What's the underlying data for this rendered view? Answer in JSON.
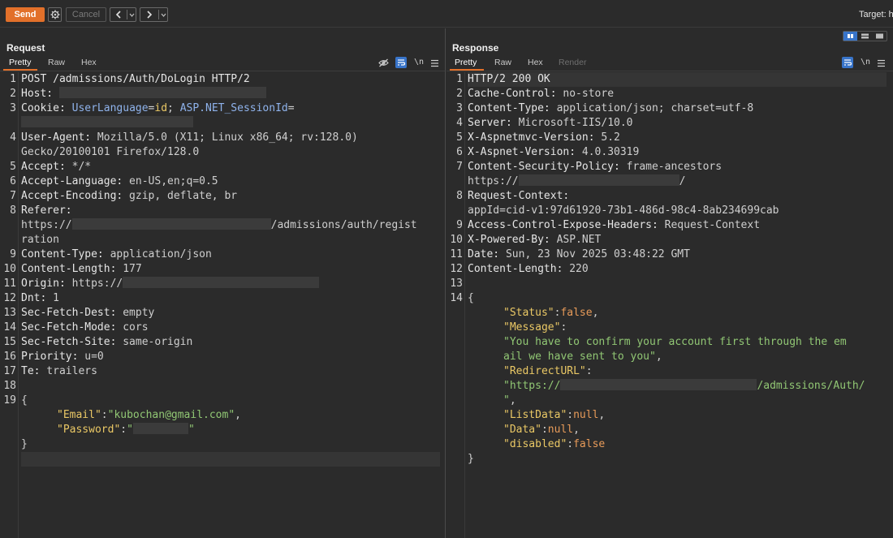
{
  "toolbar": {
    "send_label": "Send",
    "cancel_label": "Cancel",
    "target_label": "Target: h"
  },
  "request": {
    "title": "Request",
    "tabs": [
      "Pretty",
      "Raw",
      "Hex"
    ],
    "lines": {
      "l1": "POST /admissions/Auth/DoLogin HTTP/2",
      "l2k": "Host:",
      "l3k": "Cookie:",
      "l3a": "UserLanguage",
      "l3b": "=",
      "l3c": "id",
      "l3d": "; ",
      "l3e": "ASP.NET_SessionId",
      "l3f": "=",
      "l4k": "User-Agent:",
      "l4v": " Mozilla/5.0 (X11; Linux x86_64; rv:128.0)",
      "l4c": "Gecko/20100101 Firefox/128.0",
      "l5k": "Accept:",
      "l5v": " */*",
      "l6k": "Accept-Language:",
      "l6v": " en-US,en;q=0.5",
      "l7k": "Accept-Encoding:",
      "l7v": " gzip, deflate, br",
      "l8k": "Referer:",
      "l8a": "https://",
      "l8b": "/admissions/auth/regist",
      "l8c": "ration",
      "l9k": "Content-Type:",
      "l9v": " application/json",
      "l10k": "Content-Length:",
      "l10v": " 177",
      "l11k": "Origin:",
      "l11v": " https://",
      "l12k": "Dnt:",
      "l12v": " 1",
      "l13k": "Sec-Fetch-Dest:",
      "l13v": " empty",
      "l14k": "Sec-Fetch-Mode:",
      "l14v": " cors",
      "l15k": "Sec-Fetch-Site:",
      "l15v": " same-origin",
      "l16k": "Priority:",
      "l16v": " u=0",
      "l17k": "Te:",
      "l17v": " trailers",
      "b_open": "{",
      "b_email_k": "\"Email\"",
      "b_email_sep": ":",
      "b_email_v": "\"kubochan@gmail.com\"",
      "b_email_end": ",",
      "b_pw_k": "\"Password\"",
      "b_pw_sep": ":",
      "b_pw_q1": "\"",
      "b_pw_q2": "\"",
      "b_close": "}"
    }
  },
  "response": {
    "title": "Response",
    "tabs": [
      "Pretty",
      "Raw",
      "Hex",
      "Render"
    ],
    "lines": {
      "l1": "HTTP/2 200 OK",
      "l2k": "Cache-Control:",
      "l2v": " no-store",
      "l3k": "Content-Type:",
      "l3v": " application/json; charset=utf-8",
      "l4k": "Server:",
      "l4v": " Microsoft-IIS/10.0",
      "l5k": "X-Aspnetmvc-Version:",
      "l5v": " 5.2",
      "l6k": "X-Aspnet-Version:",
      "l6v": " 4.0.30319",
      "l7k": "Content-Security-Policy:",
      "l7v": " frame-ancestors",
      "l7c1": "https://",
      "l7c2": "/",
      "l8k": "Request-Context:",
      "l8c": "appId=cid-v1:97d61920-73b1-486d-98c4-8ab234699cab",
      "l9k": "Access-Control-Expose-Headers:",
      "l9v": " Request-Context",
      "l10k": "X-Powered-By:",
      "l10v": " ASP.NET",
      "l11k": "Date:",
      "l11v": " Sun, 23 Nov 2025 03:48:22 GMT",
      "l12k": "Content-Length:",
      "l12v": " 220",
      "j_open": "{",
      "j_status_k": "\"Status\"",
      "j_colon": ":",
      "j_status_v": "false",
      "j_comma": ",",
      "j_msg_k": "\"Message\"",
      "j_msg_v1": "\"You have to confirm your account first through the em",
      "j_msg_v2": "ail we have sent to you\"",
      "j_redir_k": "\"RedirectURL\"",
      "j_redir_a": "\"https://",
      "j_redir_b": "/admissions/Auth/",
      "j_redir_c": "\"",
      "j_list_k": "\"ListData\"",
      "j_list_v": "null",
      "j_data_k": "\"Data\"",
      "j_data_v": "null",
      "j_dis_k": "\"disabled\"",
      "j_dis_v": "false",
      "j_close": "}"
    }
  },
  "colors": {
    "accent": "#e2702a",
    "active_icon": "#3874c9",
    "json_key": "#eac865",
    "json_literal": "#e89b59",
    "json_string": "#91c774",
    "cookie_name": "#8fb3ec"
  },
  "icons": [
    "gear-icon",
    "chevron-left-icon",
    "chevron-right-icon",
    "chevron-down-icon",
    "eye-off-icon",
    "wrap-icon",
    "newline-icon",
    "menu-icon",
    "layout-split-icon"
  ]
}
